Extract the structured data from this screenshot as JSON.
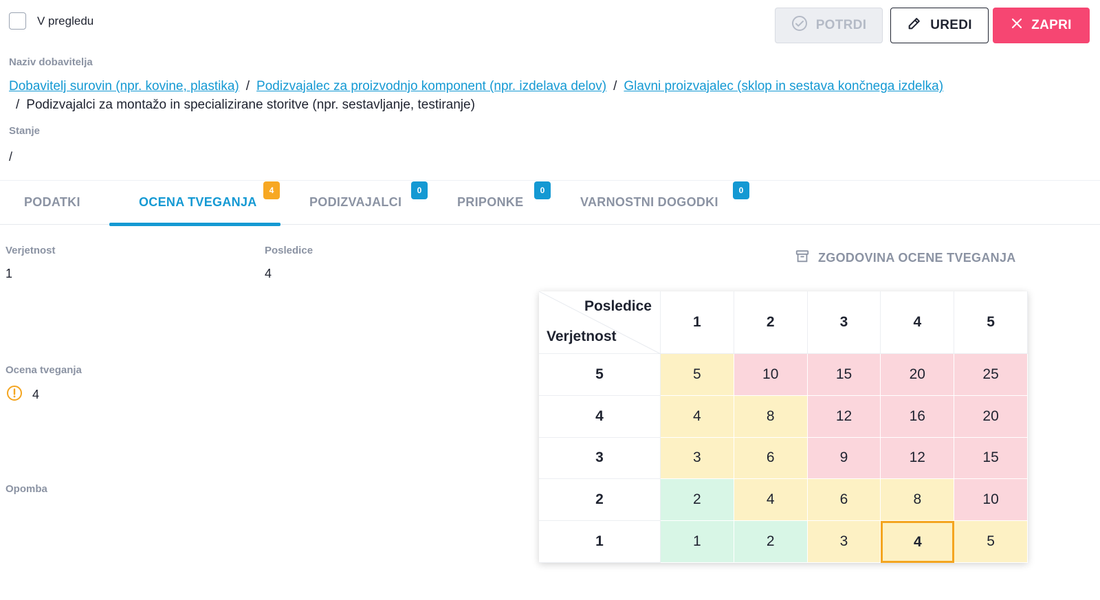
{
  "review": {
    "label": "V pregledu",
    "checked": false
  },
  "actions": {
    "confirm_label": "POTRDI",
    "edit_label": "UREDI",
    "close_label": "ZAPRI"
  },
  "supplier": {
    "label": "Naziv dobavitelja",
    "breadcrumb": [
      "Dobavitelj surovin (npr. kovine, plastika)",
      "Podizvajalec za proizvodnjo komponent (npr. izdelava delov)",
      "Glavni proizvajalec (sklop in sestava končnega izdelka)"
    ],
    "current": "Podizvajalci za montažo in specializirane storitve (npr. sestavljanje, testiranje)",
    "separator": "/"
  },
  "state": {
    "label": "Stanje",
    "value": "/"
  },
  "tabs": [
    {
      "label": "PODATKI",
      "badge": ""
    },
    {
      "label": "OCENA TVEGANJA",
      "badge": "4",
      "active": true
    },
    {
      "label": "PODIZVAJALCI",
      "badge": "0"
    },
    {
      "label": "PRIPONKE",
      "badge": "0"
    },
    {
      "label": "VARNOSTNI DOGODKI",
      "badge": "0"
    }
  ],
  "assessment": {
    "likelihood_label": "Verjetnost",
    "likelihood_value": "1",
    "consequence_label": "Posledice",
    "consequence_value": "4",
    "history_label": "ZGODOVINA OCENE TVEGANJA",
    "score_label": "Ocena tveganja",
    "score_value": "4",
    "note_label": "Opomba"
  },
  "matrix": {
    "corner_top": "Posledice",
    "corner_bottom": "Verjetnost",
    "columns": [
      "1",
      "2",
      "3",
      "4",
      "5"
    ],
    "rows": [
      {
        "label": "5",
        "cells": [
          "5",
          "10",
          "15",
          "20",
          "25"
        ],
        "levels": [
          "yellow",
          "red",
          "red",
          "red",
          "red"
        ]
      },
      {
        "label": "4",
        "cells": [
          "4",
          "8",
          "12",
          "16",
          "20"
        ],
        "levels": [
          "yellow",
          "yellow",
          "red",
          "red",
          "red"
        ]
      },
      {
        "label": "3",
        "cells": [
          "3",
          "6",
          "9",
          "12",
          "15"
        ],
        "levels": [
          "yellow",
          "yellow",
          "red",
          "red",
          "red"
        ]
      },
      {
        "label": "2",
        "cells": [
          "2",
          "4",
          "6",
          "8",
          "10"
        ],
        "levels": [
          "green",
          "yellow",
          "yellow",
          "yellow",
          "red"
        ]
      },
      {
        "label": "1",
        "cells": [
          "1",
          "2",
          "3",
          "4",
          "5"
        ],
        "levels": [
          "green",
          "green",
          "yellow",
          "yellow",
          "yellow"
        ]
      }
    ],
    "selected": {
      "row": "1",
      "column": "4"
    }
  },
  "colors": {
    "accent": "#1499d3",
    "danger": "#f64672",
    "warning": "#f4a520",
    "green": "#d8f6e6",
    "yellow": "#fdf1c4",
    "red": "#fbd6dc"
  },
  "icons": {
    "confirm": "check-circle-icon",
    "edit": "pencil-icon",
    "close": "close-icon",
    "history": "archive-icon",
    "score": "warning-circle-icon"
  }
}
